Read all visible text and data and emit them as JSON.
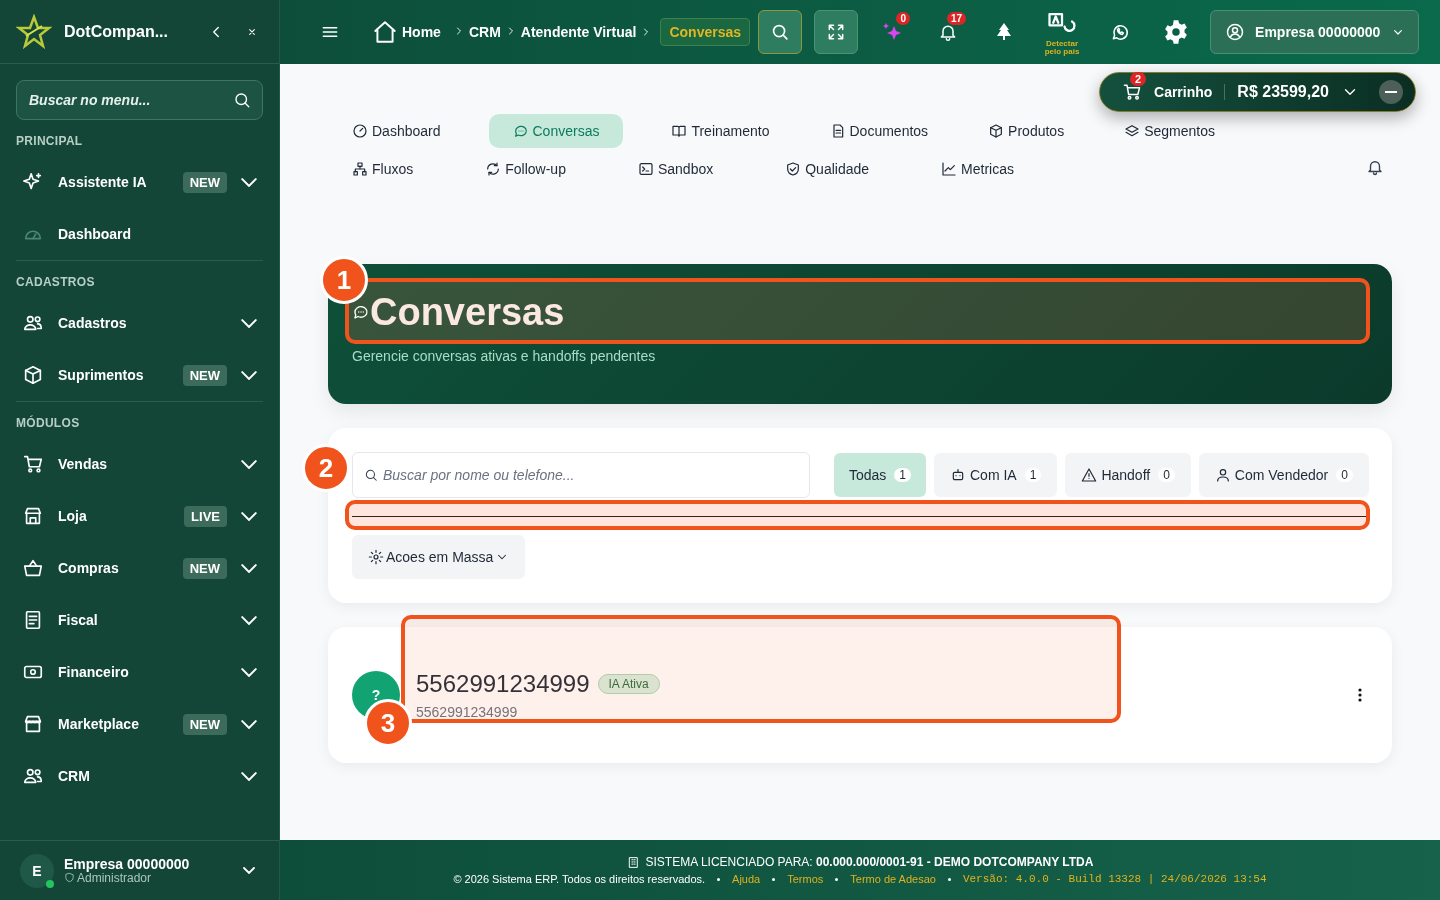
{
  "sidebar": {
    "brand": "DotCompan...",
    "search": {
      "placeholder": "Buscar no menu..."
    },
    "sections": [
      {
        "title": "PRINCIPAL",
        "items": [
          {
            "label": "Assistente IA",
            "badge": "NEW",
            "expandable": true
          },
          {
            "label": "Dashboard",
            "expandable": false
          }
        ]
      },
      {
        "title": "CADASTROS",
        "items": [
          {
            "label": "Cadastros",
            "expandable": true
          },
          {
            "label": "Suprimentos",
            "badge": "NEW",
            "expandable": true
          }
        ]
      },
      {
        "title": "MÓDULOS",
        "items": [
          {
            "label": "Vendas",
            "expandable": true
          },
          {
            "label": "Loja",
            "badge": "LIVE",
            "expandable": true
          },
          {
            "label": "Compras",
            "badge": "NEW",
            "expandable": true
          },
          {
            "label": "Fiscal",
            "expandable": true
          },
          {
            "label": "Financeiro",
            "expandable": true
          },
          {
            "label": "Marketplace",
            "badge": "NEW",
            "expandable": true
          },
          {
            "label": "CRM",
            "expandable": true
          }
        ]
      }
    ],
    "user": {
      "avatar": "E",
      "name": "Empresa 00000000",
      "role": "Administrador"
    }
  },
  "header": {
    "breadcrumb": [
      "Home",
      "CRM",
      "Atendente Virtual"
    ],
    "current": "Conversas",
    "ai_count": "0",
    "notification_count": "17",
    "language": "Detectar pelo pais",
    "company": "Empresa 00000000"
  },
  "cart": {
    "count": "2",
    "label": "Carrinho",
    "total": "R$ 23599,20"
  },
  "nav_rows": [
    [
      {
        "label": "Dashboard",
        "selected": false
      },
      {
        "label": "Conversas",
        "selected": true
      },
      {
        "label": "Treinamento",
        "selected": false
      },
      {
        "label": "Documentos",
        "selected": false
      },
      {
        "label": "Produtos",
        "selected": false
      },
      {
        "label": "Segmentos",
        "selected": false
      }
    ],
    [
      {
        "label": "Fluxos",
        "selected": false
      },
      {
        "label": "Follow-up",
        "selected": false
      },
      {
        "label": "Sandbox",
        "selected": false
      },
      {
        "label": "Qualidade",
        "selected": false
      },
      {
        "label": "Metricas",
        "selected": false
      }
    ]
  ],
  "hero": {
    "title": "Conversas",
    "subtitle": "Gerencie conversas ativas e handoffs pendentes"
  },
  "filters": {
    "search": {
      "placeholder": "Buscar por nome ou telefone..."
    },
    "tabs": [
      {
        "label": "Todas",
        "count": "1",
        "selected": true
      },
      {
        "label": "Com IA",
        "count": "1",
        "selected": false
      },
      {
        "label": "Handoff",
        "count": "0",
        "selected": false
      },
      {
        "label": "Com Vendedor",
        "count": "0",
        "selected": false
      }
    ],
    "bulk_actions": "Acoes em Massa"
  },
  "conversations": [
    {
      "avatar": "?",
      "name": "5562991234999",
      "tag": "IA Ativa",
      "phone": "5562991234999"
    }
  ],
  "tour_steps": [
    "1",
    "2",
    "3"
  ],
  "footer": {
    "license": "SISTEMA LICENCIADO PARA: **00.000.000/0001-91 - DEMO DOTCOMPANY LTDA**",
    "copyright": "© 2026 Sistema ERP. Todos os direitos reservados.",
    "links": [
      "Ajuda",
      "Termos",
      "Termo de Adesao"
    ],
    "version": "Versão: 4.0.0 - Build 13328 | 24/06/2026 13:54"
  }
}
